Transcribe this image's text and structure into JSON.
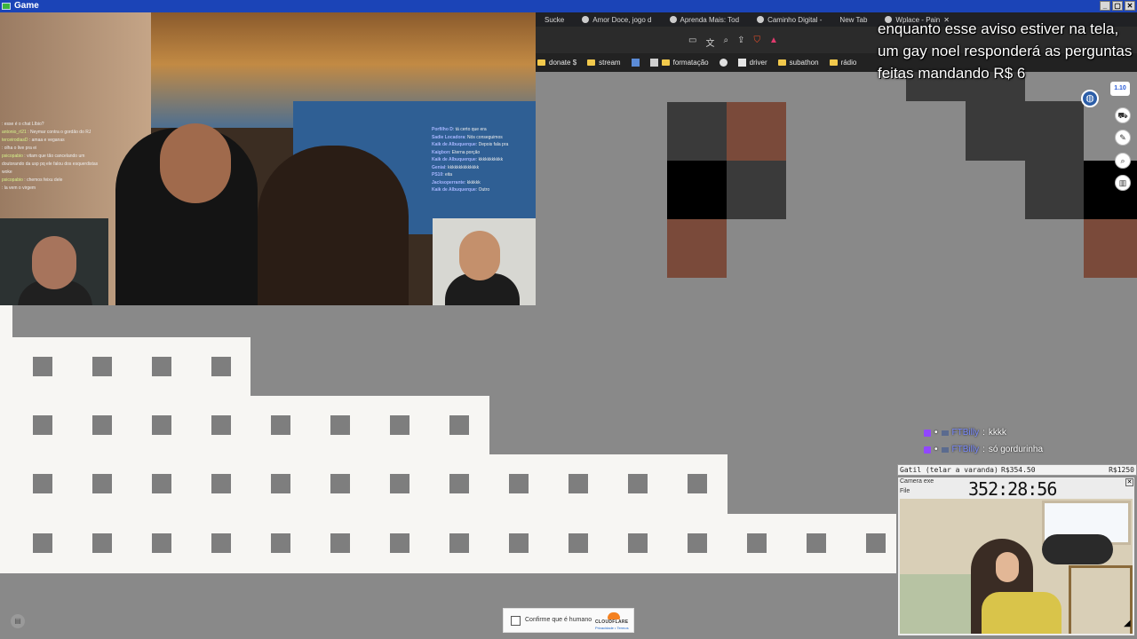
{
  "window": {
    "title": "Game",
    "controls": [
      "_",
      "▢",
      "✕"
    ]
  },
  "stream": {
    "chat_left": [
      {
        "user": "",
        "text": "esse é o chat LIbio?"
      },
      {
        "user": "antonio_rt21",
        "text": "Neymar contra o gordão do RJ"
      },
      {
        "user": "terceirodiasD",
        "text": "amaa e veganas"
      },
      {
        "user": "",
        "text": "olha o live pra ei"
      },
      {
        "user": "psicopabio",
        "text": "vitam que tão cancelando um doutorando da usp pq ele falou dos esquerdistas woke"
      },
      {
        "user": "psicopabio",
        "text": "chemos feixu dele"
      },
      {
        "user": "",
        "text": "la vem o virgem"
      }
    ],
    "chat_right": [
      {
        "user": "Porfilho D",
        "text": "tá certo que era"
      },
      {
        "user": "Sadie Locadora",
        "text": "Nós conseguimos"
      },
      {
        "user": "Kaik de Albuquerque",
        "text": "Depois fala pra"
      },
      {
        "user": "Kaigbon",
        "text": "Eterna porção"
      },
      {
        "user": "Kaik de Albuquerque",
        "text": "kkkkkkkkkkk"
      },
      {
        "user": "Genial",
        "text": "kkkkkkkkkkkkkk"
      },
      {
        "user": "PS10",
        "text": "eita"
      },
      {
        "user": "Jacksoperrante",
        "text": "kkkkkk"
      },
      {
        "user": "Kaik de Albuquerque",
        "text": "Outro"
      }
    ]
  },
  "browser": {
    "tabs": [
      "Sucke",
      "Amor Doce, jogo d",
      "Aprenda Mais: Tod",
      "Caminho Digital -",
      "New Tab",
      "Wplace - Pain"
    ],
    "bookmarks": [
      {
        "label": "donate $",
        "icon": "folder-icon"
      },
      {
        "label": "stream",
        "icon": "folder-icon"
      },
      {
        "label": "",
        "icon": "app-icon"
      },
      {
        "label": "formatação",
        "icon": "folder-icon"
      },
      {
        "label": "",
        "icon": "chrome-icon"
      },
      {
        "label": "driver",
        "icon": "page-icon"
      },
      {
        "label": "subathon",
        "icon": "folder-icon"
      },
      {
        "label": "rádio",
        "icon": "folder-icon"
      }
    ]
  },
  "announcement": "enquanto esse aviso estiver na tela, um gay noel responderá as perguntas feitas mandando R$ 6",
  "canvas": {
    "badge": "1.10",
    "side_buttons": [
      "store-icon",
      "paint-icon",
      "search-icon",
      "stats-icon"
    ]
  },
  "overlay_chat": [
    {
      "user": "FTBilly",
      "text": "kkkk"
    },
    {
      "user": "FTBilly",
      "text": "só gordurinha"
    }
  ],
  "webcam": {
    "bar_title": "Gatil (telar a varanda)",
    "bar_amount": "R$354.50",
    "bar_goal": "R$1250",
    "window_title": "Camera exe",
    "window_menu": "File",
    "timer": "352:28:56"
  },
  "captcha": {
    "label": "Confirme que é humano",
    "brand": "CLOUDFLARE",
    "links": "Privacidade • Termos"
  },
  "colors": {
    "brown": "#7a4a3a",
    "dark": "#3a3a3a",
    "black": "#000000",
    "canvas_bg": "#898989",
    "building": "#f7f6f3",
    "window": "#7e7e7e"
  }
}
